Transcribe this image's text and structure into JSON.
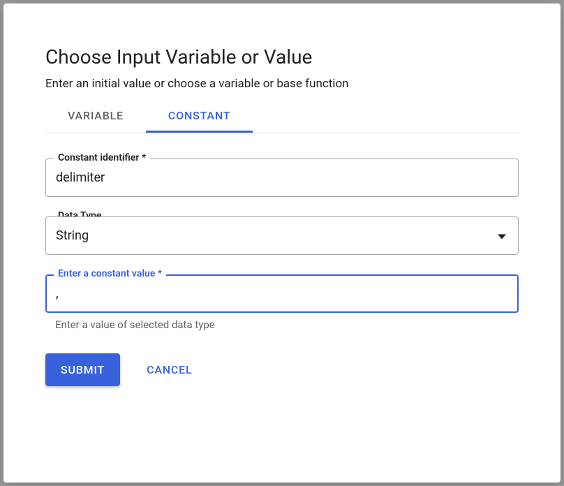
{
  "dialog": {
    "title": "Choose Input Variable or Value",
    "subtitle": "Enter an initial value or choose a variable or base function"
  },
  "tabs": {
    "variable": "VARIABLE",
    "constant": "CONSTANT"
  },
  "fields": {
    "identifier": {
      "label": "Constant identifier *",
      "value": "delimiter"
    },
    "dataType": {
      "label": "Data Type",
      "value": "String"
    },
    "constantValue": {
      "label": "Enter a constant value *",
      "value": ",",
      "helper": "Enter a value of selected data type"
    }
  },
  "buttons": {
    "submit": "SUBMIT",
    "cancel": "CANCEL"
  }
}
